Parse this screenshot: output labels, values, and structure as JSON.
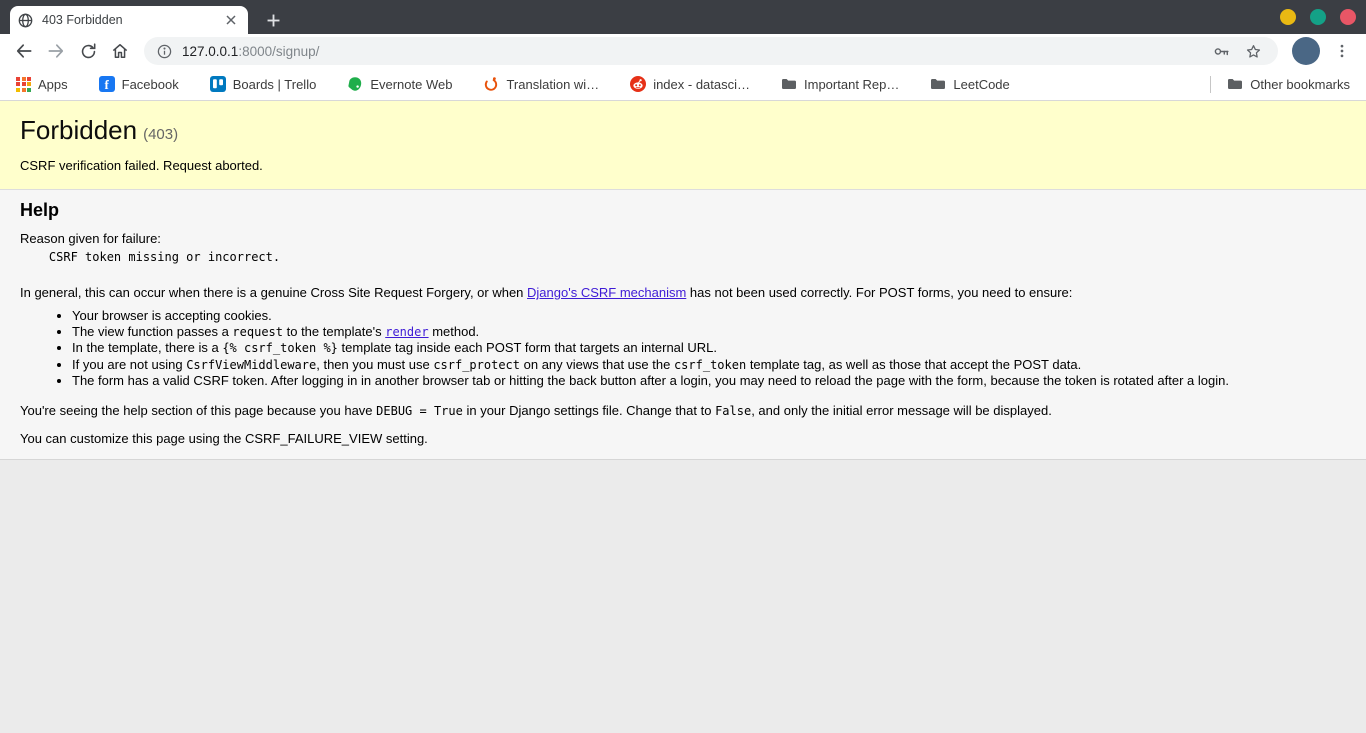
{
  "browser": {
    "window_title": "403 Forbidden",
    "tab": {
      "title": "403 Forbidden"
    },
    "url": {
      "host": "127.0.0.1",
      "rest": ":8000/signup/"
    },
    "bookmarks": [
      {
        "label": "Apps",
        "icon": "apps-grid-icon"
      },
      {
        "label": "Facebook",
        "icon": "facebook-icon"
      },
      {
        "label": "Boards | Trello",
        "icon": "trello-icon"
      },
      {
        "label": "Evernote Web",
        "icon": "evernote-icon"
      },
      {
        "label": "Translation wi…",
        "icon": "flame-ring-icon"
      },
      {
        "label": "index - datasci…",
        "icon": "reddit-icon"
      },
      {
        "label": "Important Rep…",
        "icon": "folder-icon"
      },
      {
        "label": "LeetCode",
        "icon": "folder-icon"
      }
    ],
    "other_bookmarks": {
      "label": "Other bookmarks",
      "icon": "folder-icon"
    },
    "icons": {
      "tab_favicon": "globe",
      "tab_close": "✕",
      "new_tab": "+",
      "back": "←",
      "forward": "→",
      "reload": "⟳",
      "home": "⌂",
      "page_info": "ⓘ",
      "password_key": "key",
      "bookmark_star": "☆",
      "browser_menu": "⋮",
      "bookmark_folder": "folder"
    }
  },
  "page": {
    "summary": {
      "title": "Forbidden",
      "status_code": "(403)",
      "message": "CSRF verification failed. Request aborted."
    },
    "help": {
      "heading": "Help",
      "reason_label": "Reason given for failure:",
      "reason": "    CSRF token missing or incorrect.",
      "intro": {
        "text_before": "In general, this can occur when there is a genuine Cross Site Request Forgery, or when ",
        "link": "Django's CSRF mechanism",
        "text_after": " has not been used correctly. For POST forms, you need to ensure:"
      },
      "bullets": {
        "item1": "Your browser is accepting cookies.",
        "item2": {
          "a": "The view function passes a ",
          "code1": "request",
          "b": " to the template's ",
          "link": "render",
          "c": " method."
        },
        "item3": {
          "a": "In the template, there is a ",
          "code1": "{% csrf_token %}",
          "b": " template tag inside each POST form that targets an internal URL."
        },
        "item4": {
          "a": "If you are not using ",
          "code1": "CsrfViewMiddleware",
          "b": ", then you must use ",
          "code2": "csrf_protect",
          "c": " on any views that use the ",
          "code3": "csrf_token",
          "d": " template tag, as well as those that accept the POST data."
        },
        "item5": "The form has a valid CSRF token. After logging in in another browser tab or hitting the back button after a login, you may need to reload the page with the form, because the token is rotated after a login."
      },
      "debug_note": {
        "a": "You're seeing the help section of this page because you have ",
        "code1": "DEBUG = True",
        "b": " in your Django settings file. Change that to ",
        "code2": "False",
        "c": ", and only the initial error message will be displayed."
      }
    },
    "explanation": "You can customize this page using the CSRF_FAILURE_VIEW setting."
  },
  "colors": {
    "summary_bg": "#ffffcc",
    "help_bg": "#f6f6f6",
    "page_bg": "#ebebeb",
    "link": "#3e1bd6",
    "window_dot_minimize": "#e9b913",
    "window_dot_maximize": "#14a187",
    "window_dot_close": "#e85666"
  }
}
